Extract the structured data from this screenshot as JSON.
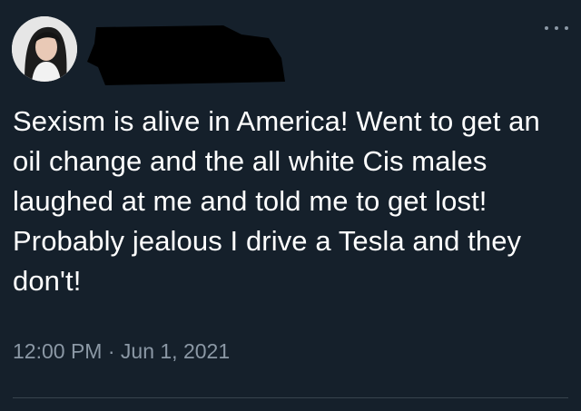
{
  "tweet": {
    "text": "Sexism is alive in America! Went to get an oil change and the all white Cis males laughed at me and told me to get lost! Probably jealous I drive a Tesla and they don't!",
    "time": "12:00 PM",
    "separator": "·",
    "date": "Jun 1, 2021"
  },
  "icons": {
    "more": "more-horizontal-icon"
  },
  "colors": {
    "background": "#15202b",
    "text": "#ffffff",
    "muted": "#8b98a5",
    "divider": "#38444d"
  }
}
